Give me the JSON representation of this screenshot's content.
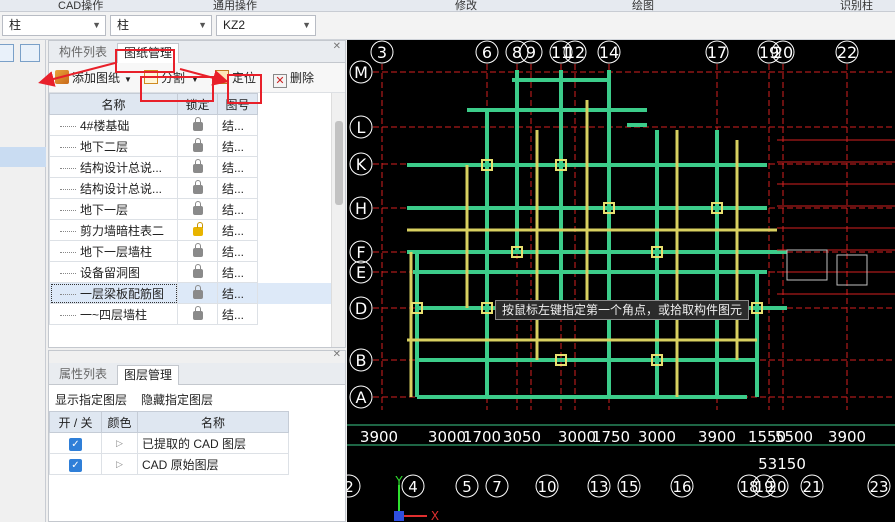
{
  "top_menu": [
    "CAD操作",
    "通用操作",
    "修改",
    "绘图",
    "识别柱"
  ],
  "selectors": [
    {
      "value": "柱"
    },
    {
      "value": "柱"
    },
    {
      "value": "KZ2"
    }
  ],
  "drawing_panel": {
    "tabs": [
      "构件列表",
      "图纸管理"
    ],
    "active_tab": "图纸管理",
    "toolbar": {
      "add": "添加图纸",
      "split": "分割",
      "locate": "定位",
      "delete": "删除"
    },
    "columns": [
      "名称",
      "锁定",
      "图号"
    ],
    "rows": [
      {
        "name": "4#楼基础",
        "locked": true,
        "number": "结..."
      },
      {
        "name": "地下二层",
        "locked": true,
        "number": "结..."
      },
      {
        "name": "结构设计总说...",
        "locked": true,
        "number": "结..."
      },
      {
        "name": "结构设计总说...",
        "locked": true,
        "number": "结..."
      },
      {
        "name": "地下一层",
        "locked": true,
        "number": "结..."
      },
      {
        "name": "剪力墙暗柱表二",
        "locked": false,
        "number": "结..."
      },
      {
        "name": "地下一层墙柱",
        "locked": true,
        "number": "结..."
      },
      {
        "name": "设备留洞图",
        "locked": true,
        "number": "结..."
      },
      {
        "name": "一层梁板配筋图",
        "locked": true,
        "number": "结...",
        "selected": true
      },
      {
        "name": "一~四层墙柱",
        "locked": true,
        "number": "结..."
      }
    ]
  },
  "layer_panel": {
    "tabs": [
      "属性列表",
      "图层管理"
    ],
    "active_tab": "图层管理",
    "actions": {
      "show": "显示指定图层",
      "hide": "隐藏指定图层"
    },
    "columns": [
      "开 / 关",
      "颜色",
      "名称"
    ],
    "rows": [
      {
        "on": true,
        "name": "已提取的 CAD 图层"
      },
      {
        "on": true,
        "name": "CAD 原始图层"
      }
    ]
  },
  "cad": {
    "tooltip": "按鼠标左键指定第一个角点，或拾取构件图元",
    "top_axes": [
      "3",
      "6",
      "8",
      "9",
      "11",
      "12",
      "14",
      "17",
      "19",
      "20",
      "22"
    ],
    "left_axes": [
      "M",
      "L",
      "K",
      "H",
      "F",
      "E",
      "D",
      "B",
      "A"
    ],
    "dims_row": [
      "3900",
      "3000",
      "1700",
      "3050",
      "3000",
      "1750",
      "3000",
      "3900",
      "1550",
      "5500",
      "3900"
    ],
    "total_dim": "53150",
    "bottom_axes": [
      "2",
      "4",
      "5",
      "7",
      "10",
      "13",
      "15",
      "16",
      "18",
      "19",
      "20",
      "21",
      "23"
    ],
    "ucs_labels": {
      "y": "Y",
      "x": "X"
    }
  }
}
